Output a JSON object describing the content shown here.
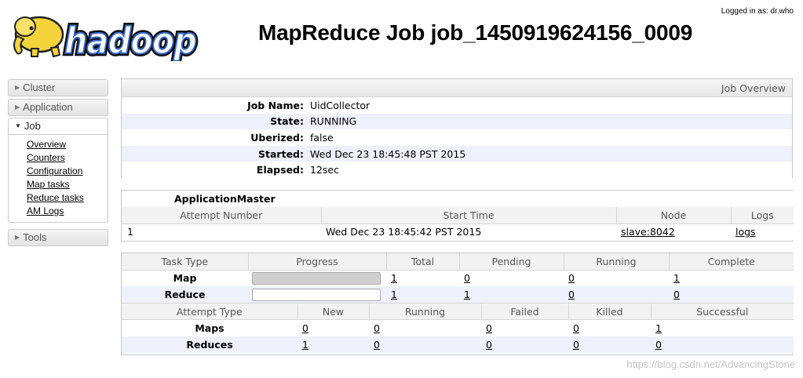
{
  "header": {
    "logo_text": "hadoop",
    "title": "MapReduce Job job_1450919624156_0009",
    "logged_in": "Logged in as: dr.who"
  },
  "sidebar": {
    "cluster": "Cluster",
    "application": "Application",
    "job": "Job",
    "job_links": [
      "Overview",
      "Counters",
      "Configuration",
      "Map tasks",
      "Reduce tasks",
      "AM Logs"
    ],
    "tools": "Tools"
  },
  "overview": {
    "title": "Job Overview",
    "rows": [
      {
        "label": "Job Name:",
        "value": "UidCollector"
      },
      {
        "label": "State:",
        "value": "RUNNING"
      },
      {
        "label": "Uberized:",
        "value": "false"
      },
      {
        "label": "Started:",
        "value": "Wed Dec 23 18:45:48 PST 2015"
      },
      {
        "label": "Elapsed:",
        "value": "12sec"
      }
    ]
  },
  "app_master": {
    "title": "ApplicationMaster",
    "headers": [
      "Attempt Number",
      "Start Time",
      "Node",
      "Logs"
    ],
    "row": {
      "attempt": "1",
      "start_time": "Wed Dec 23 18:45:42 PST 2015",
      "node": "slave:8042",
      "logs": "logs"
    }
  },
  "tasks": {
    "headers": [
      "Task Type",
      "Progress",
      "Total",
      "Pending",
      "Running",
      "Complete"
    ],
    "rows": [
      {
        "type": "Map",
        "progress": 1.0,
        "total": "1",
        "pending": "0",
        "running": "0",
        "complete": "1"
      },
      {
        "type": "Reduce",
        "progress": 0.0,
        "total": "1",
        "pending": "1",
        "running": "0",
        "complete": "0"
      }
    ],
    "attempt_headers": [
      "Attempt Type",
      "New",
      "Running",
      "Failed",
      "Killed",
      "Successful"
    ],
    "attempt_rows": [
      {
        "type": "Maps",
        "new": "0",
        "running": "0",
        "failed": "0",
        "killed": "0",
        "successful": "1"
      },
      {
        "type": "Reduces",
        "new": "1",
        "running": "0",
        "failed": "0",
        "killed": "0",
        "successful": "0"
      }
    ]
  },
  "watermark": "https://blog.csdn.net/AdvancingStone",
  "colors": {
    "row_stripe": "#eef1fb",
    "progress_fill": "#cfcfcf",
    "elephant": "#f5d33a"
  }
}
